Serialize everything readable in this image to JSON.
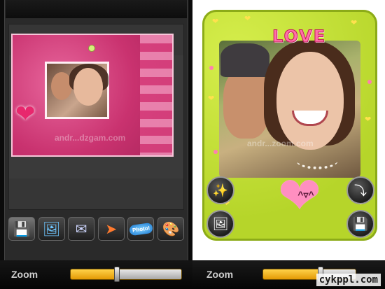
{
  "left_screen": {
    "toolbar": {
      "buttons": [
        {
          "name": "save",
          "icon": "floppy-disk-icon",
          "glyph": "💾"
        },
        {
          "name": "gallery",
          "icon": "photos-icon",
          "glyph": "🖼"
        },
        {
          "name": "email",
          "icon": "envelope-icon",
          "glyph": "✉"
        },
        {
          "name": "share",
          "icon": "rocket-icon",
          "glyph": "➤"
        },
        {
          "name": "photo-bubble",
          "icon": "photo-badge-icon",
          "label": "Photo!"
        },
        {
          "name": "effects",
          "icon": "palette-icon",
          "glyph": "🎨"
        }
      ]
    },
    "zoom": {
      "label": "Zoom",
      "level": 0.42
    },
    "watermark": "andr...dzgam.com"
  },
  "right_screen": {
    "frame_title": "LOVE",
    "buttons": [
      {
        "name": "magic-wand",
        "icon": "magic-wand-icon",
        "glyph": "✨"
      },
      {
        "name": "gallery",
        "icon": "landscape-photo-icon",
        "glyph": "🖼"
      },
      {
        "name": "rotate",
        "icon": "rotate-icon",
        "glyph": "⤵"
      },
      {
        "name": "save",
        "icon": "floppy-disk-icon",
        "glyph": "💾"
      }
    ],
    "zoom": {
      "label": "Zoom",
      "level": 0.62
    },
    "watermark": "andr...zoom.com"
  },
  "site_watermark": "cykppl.com",
  "colors": {
    "zoom_fill": "#f0b21a",
    "pink_frame": "#c9326f",
    "green_frame": "#b6d52a"
  }
}
